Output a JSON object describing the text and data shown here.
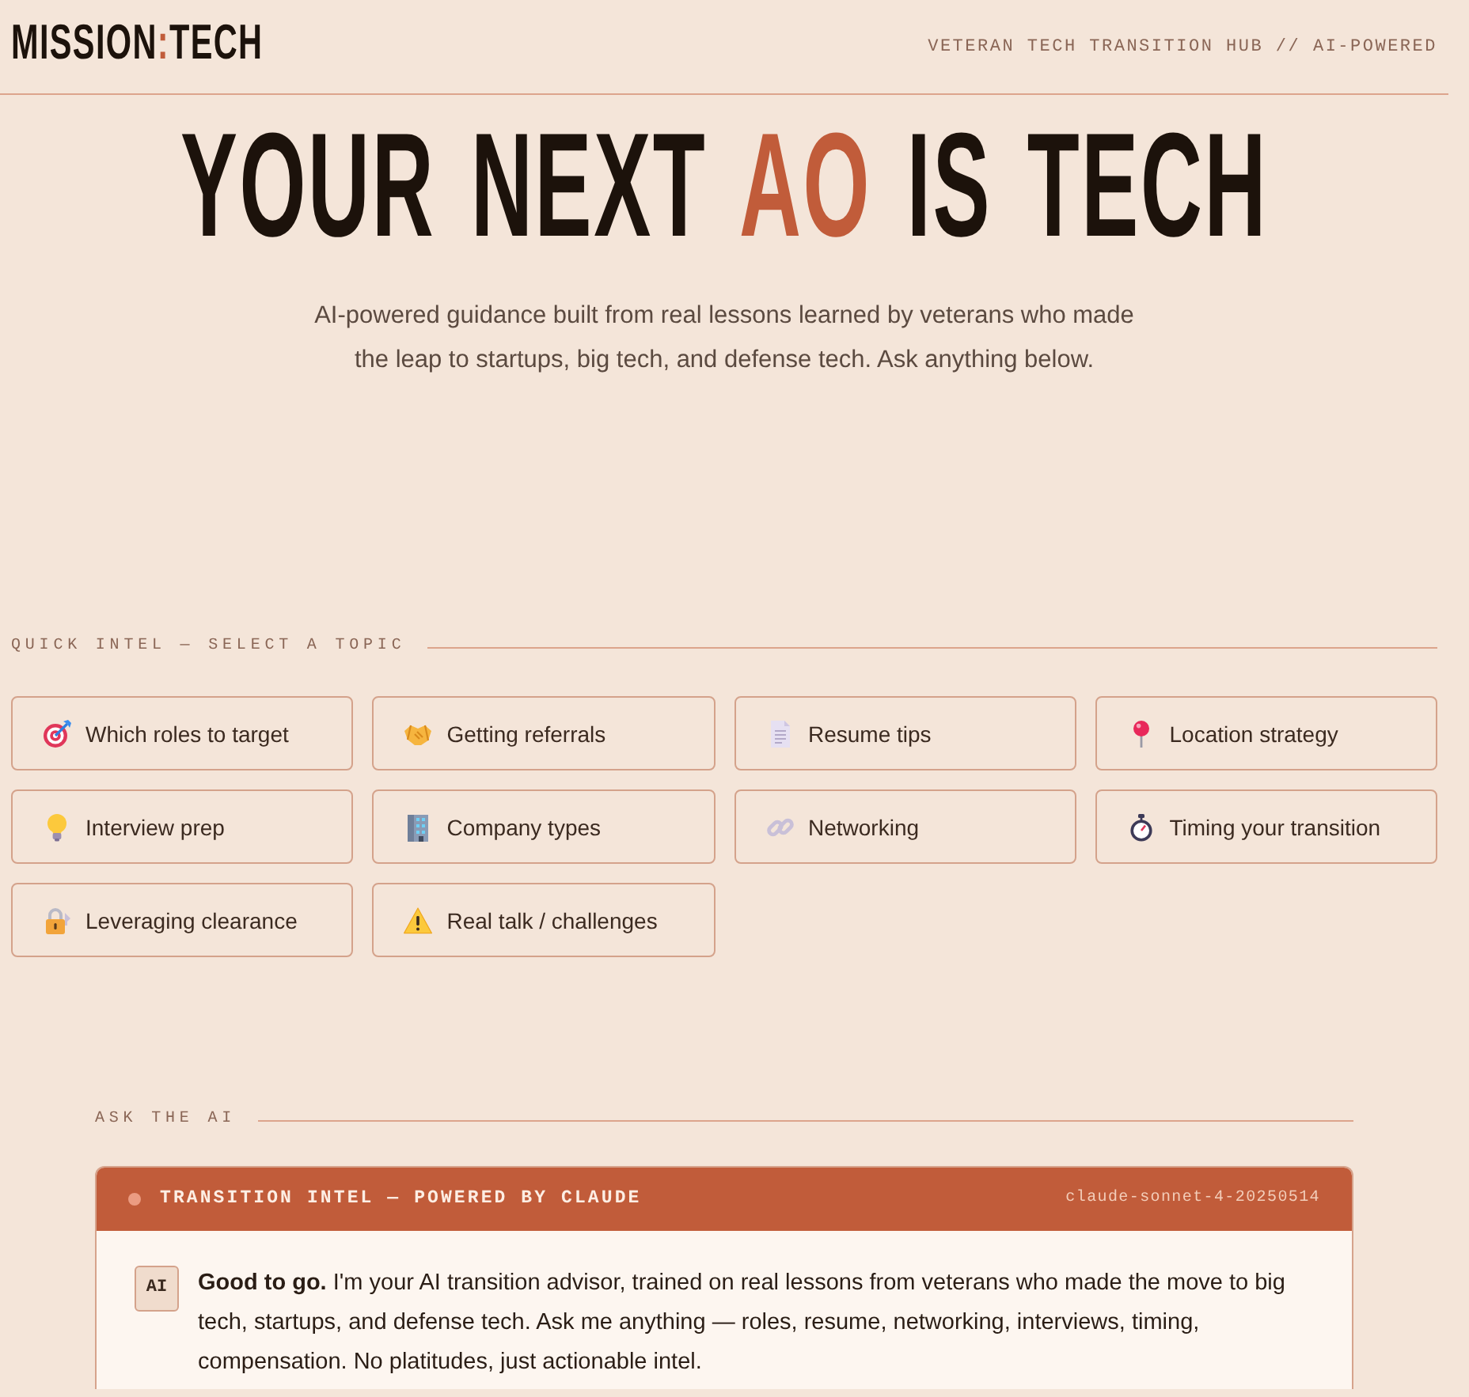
{
  "header": {
    "logo": [
      {
        "text": "MISSION",
        "accent": false
      },
      {
        "text": ":",
        "accent": true
      },
      {
        "text": "TECH",
        "accent": false
      }
    ],
    "tagline": "VETERAN TECH TRANSITION HUB // AI-POWERED"
  },
  "hero": {
    "headline": [
      {
        "text": "YOUR NEXT",
        "accent": false
      },
      {
        "text": "AO",
        "accent": true
      },
      {
        "text": "IS TECH",
        "accent": false
      }
    ],
    "subtitle": "AI-powered guidance built from real lessons learned by veterans who made the leap to startups, big tech, and defense tech. Ask anything below."
  },
  "quick_intel": {
    "label": "QUICK INTEL — SELECT A TOPIC",
    "topics": [
      "Which roles to target",
      "Getting referrals",
      "Resume tips",
      "Location strategy",
      "Interview prep",
      "Company types",
      "Networking",
      "Timing your transition",
      "Leveraging clearance",
      "Real talk / challenges"
    ]
  },
  "ask": {
    "label": "ASK THE AI",
    "chat": {
      "title": "TRANSITION INTEL — POWERED BY CLAUDE",
      "model": "claude-sonnet-4-20250514",
      "messages": [
        {
          "sender": "AI",
          "text": "**Good to go.** I'm your AI transition advisor, trained on real lessons from veterans who made the move to big tech, startups, and defense tech. Ask me anything — roles, resume, networking, interviews, timing, compensation. No platitudes, just actionable intel."
        }
      ]
    }
  }
}
